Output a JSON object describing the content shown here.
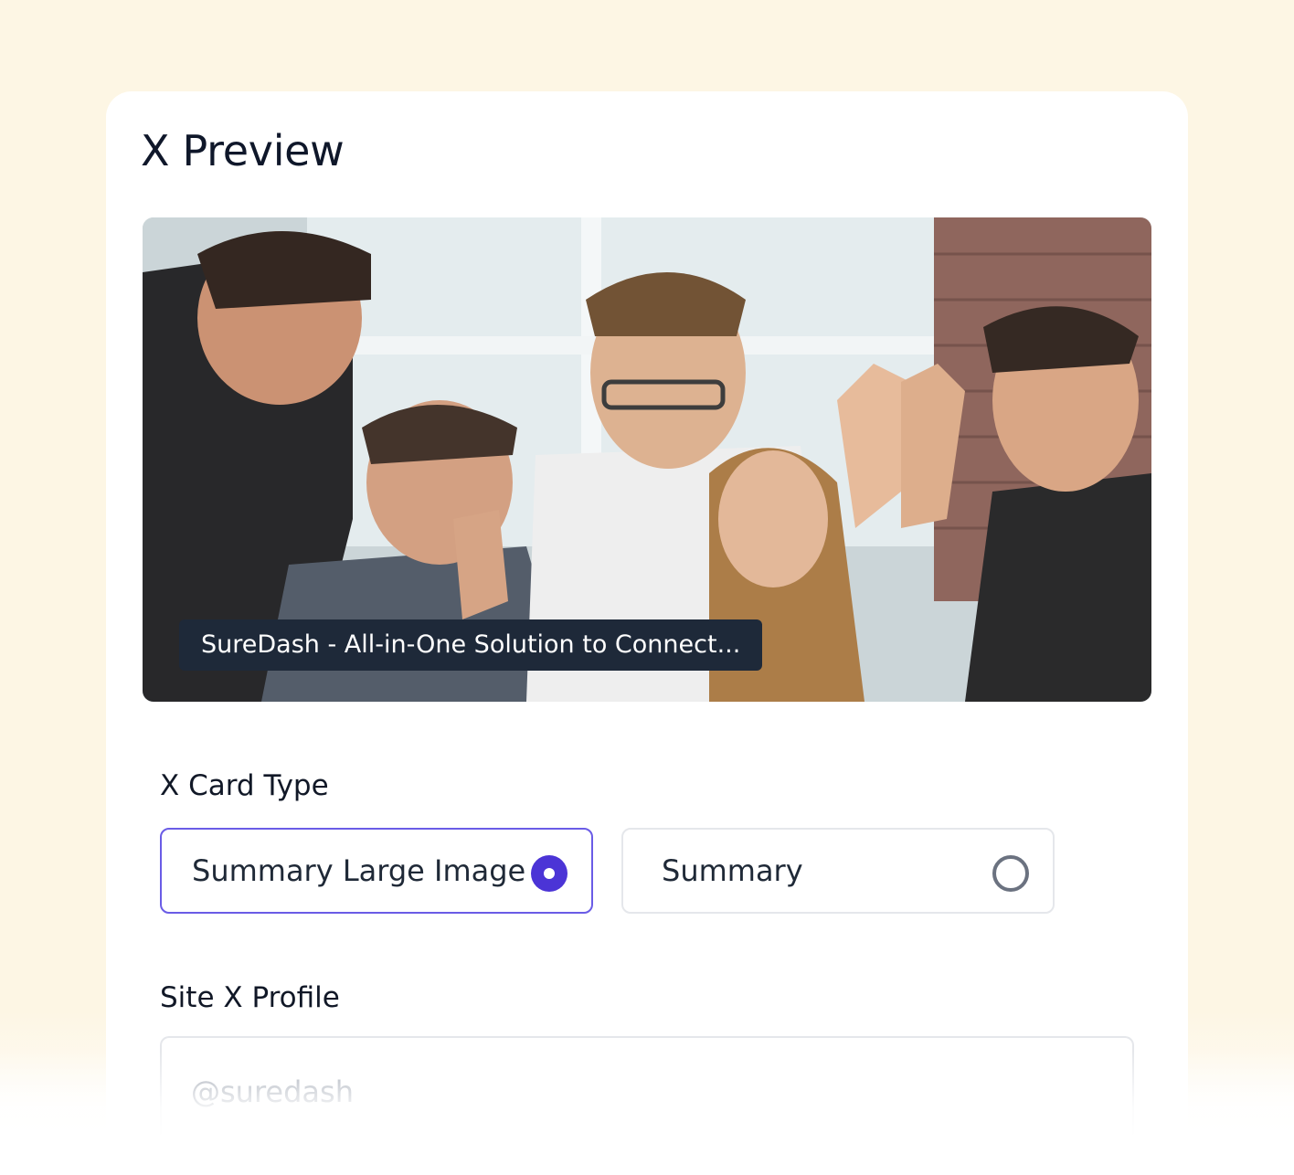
{
  "panel": {
    "title": "X Preview"
  },
  "preview": {
    "image_icon": "photo-of-group-high-five",
    "caption": "SureDash - All-in-One Solution to Connect..."
  },
  "card_type": {
    "label": "X Card Type",
    "options": [
      {
        "label": "Summary Large Image",
        "selected": true
      },
      {
        "label": "Summary",
        "selected": false
      }
    ]
  },
  "profile": {
    "label": "Site X Profile",
    "value": "",
    "placeholder": "@suredash"
  },
  "colors": {
    "background": "#fdf6e4",
    "accent": "#4b34d6",
    "selected_border": "#6a5ce6",
    "caption_bg": "#1e2939"
  }
}
